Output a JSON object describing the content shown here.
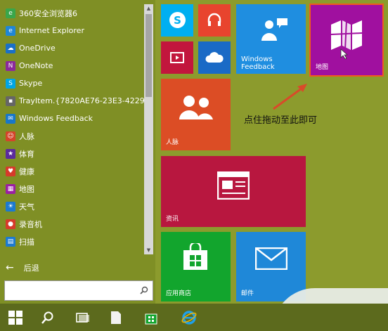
{
  "start_menu": {
    "apps": [
      {
        "label": "360安全浏览器6",
        "icon": "360-browser-icon",
        "color": "#3aa64a"
      },
      {
        "label": "Internet Explorer",
        "icon": "ie-icon",
        "color": "#1f86d6"
      },
      {
        "label": "OneDrive",
        "icon": "onedrive-icon",
        "color": "#1a70c8"
      },
      {
        "label": "OneNote",
        "icon": "onenote-icon",
        "color": "#8b2a9b"
      },
      {
        "label": "Skype",
        "icon": "skype-icon",
        "color": "#00a5e4"
      },
      {
        "label": "TrayItem.{7820AE76-23E3-4229-82C1",
        "icon": "tray-item-icon",
        "color": "#666666"
      },
      {
        "label": "Windows Feedback",
        "icon": "feedback-icon",
        "color": "#1877c9"
      },
      {
        "label": "人脉",
        "icon": "people-icon",
        "color": "#d4442a"
      },
      {
        "label": "体育",
        "icon": "sports-icon",
        "color": "#5b2b9c"
      },
      {
        "label": "健康",
        "icon": "health-icon",
        "color": "#d63a2b"
      },
      {
        "label": "地图",
        "icon": "maps-icon",
        "color": "#9b1fa3"
      },
      {
        "label": "天气",
        "icon": "weather-icon",
        "color": "#1c7ad0"
      },
      {
        "label": "录音机",
        "icon": "recorder-icon",
        "color": "#d63a2b"
      },
      {
        "label": "扫描",
        "icon": "scan-icon",
        "color": "#1c7ad0"
      }
    ],
    "back_label": "后退",
    "search_placeholder": ""
  },
  "tiles": {
    "skype": {
      "label": "",
      "color": "#00aff0"
    },
    "music": {
      "label": "",
      "color": "#e8442e"
    },
    "video": {
      "label": "",
      "color": "#c2163d"
    },
    "onedrive": {
      "label": "",
      "color": "#1a6ac6"
    },
    "feedback": {
      "label": "Windows\nFeedback",
      "line1": "Windows",
      "line2": "Feedback",
      "color": "#1f8ee0"
    },
    "maps": {
      "label": "地图",
      "color": "#a0109f"
    },
    "people": {
      "label": "人脉",
      "color": "#dc4d25"
    },
    "news": {
      "label": "资讯",
      "color": "#b8173f"
    },
    "store": {
      "label": "应用商店",
      "color": "#12a52d"
    },
    "mail": {
      "label": "邮件",
      "color": "#1f88d8"
    }
  },
  "annotation": {
    "text": "点住拖动至此即可",
    "arrow_color": "#d94a2a"
  },
  "colors": {
    "highlight_border": "#f05a1e"
  }
}
